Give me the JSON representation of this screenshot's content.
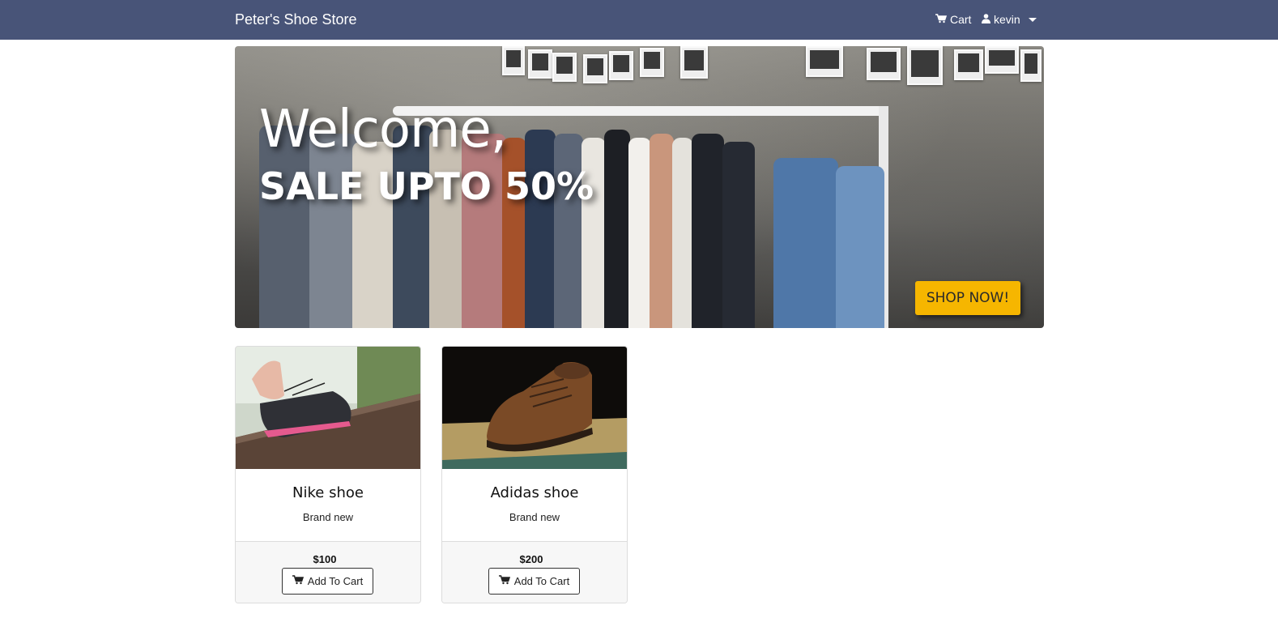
{
  "navbar": {
    "brand": "Peter's Shoe Store",
    "cart_label": "Cart",
    "user_label": "kevin"
  },
  "hero": {
    "title": "Welcome,",
    "subtitle": "SALE UPTO 50%",
    "button_label": "SHOP NOW!"
  },
  "products": [
    {
      "name": "Nike shoe",
      "description": "Brand new",
      "price": "$100",
      "button_label": "Add To Cart"
    },
    {
      "name": "Adidas shoe",
      "description": "Brand new",
      "price": "$200",
      "button_label": "Add To Cart"
    }
  ],
  "icons": {
    "cart": "shopping-cart-icon",
    "user": "user-icon",
    "dropdown": "caret-down-icon"
  },
  "colors": {
    "navbar": "#485478",
    "shop_button": "#f6b600"
  }
}
